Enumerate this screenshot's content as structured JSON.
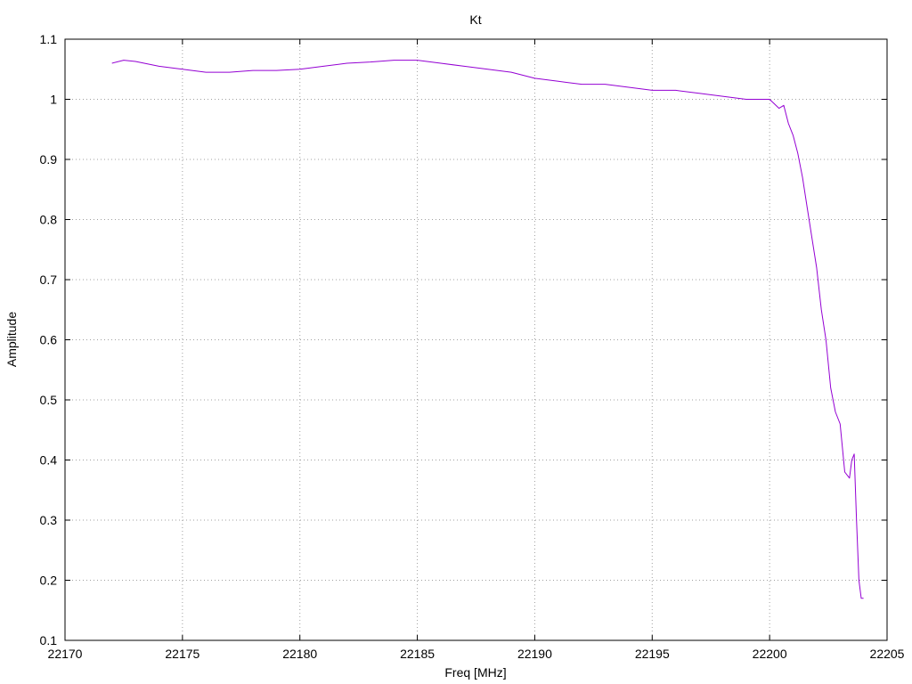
{
  "chart_data": {
    "type": "line",
    "title": "Kt",
    "xlabel": "Freq [MHz]",
    "ylabel": "Amplitude",
    "xlim": [
      22170,
      22205
    ],
    "ylim": [
      0.1,
      1.1
    ],
    "x_ticks": [
      "22170",
      "22175",
      "22180",
      "22185",
      "22190",
      "22195",
      "22200",
      "22205"
    ],
    "y_ticks": [
      "0.1",
      "0.2",
      "0.3",
      "0.4",
      "0.5",
      "0.6",
      "0.7",
      "0.8",
      "0.9",
      "1",
      "1.1"
    ],
    "grid": true,
    "series": [
      {
        "color": "#9400d3",
        "x": [
          22172.0,
          22172.5,
          22173.0,
          22174.0,
          22175.0,
          22176.0,
          22177.0,
          22178.0,
          22179.0,
          22180.0,
          22181.0,
          22182.0,
          22183.0,
          22184.0,
          22185.0,
          22186.0,
          22187.0,
          22188.0,
          22189.0,
          22190.0,
          22191.0,
          22192.0,
          22193.0,
          22194.0,
          22195.0,
          22196.0,
          22197.0,
          22198.0,
          22199.0,
          22199.5,
          22200.0,
          22200.4,
          22200.6,
          22200.8,
          22201.0,
          22201.2,
          22201.4,
          22201.6,
          22201.8,
          22202.0,
          22202.2,
          22202.4,
          22202.6,
          22202.8,
          22203.0,
          22203.2,
          22203.4,
          22203.5,
          22203.6,
          22203.7,
          22203.8,
          22203.9,
          22204.0
        ],
        "y": [
          1.06,
          1.065,
          1.063,
          1.055,
          1.05,
          1.045,
          1.045,
          1.048,
          1.048,
          1.05,
          1.055,
          1.06,
          1.062,
          1.065,
          1.065,
          1.06,
          1.055,
          1.05,
          1.045,
          1.035,
          1.03,
          1.025,
          1.025,
          1.02,
          1.015,
          1.015,
          1.01,
          1.005,
          1.0,
          1.0,
          1.0,
          0.985,
          0.99,
          0.96,
          0.94,
          0.91,
          0.87,
          0.82,
          0.77,
          0.72,
          0.65,
          0.6,
          0.52,
          0.48,
          0.46,
          0.38,
          0.37,
          0.4,
          0.41,
          0.3,
          0.2,
          0.17,
          0.17
        ]
      }
    ]
  }
}
